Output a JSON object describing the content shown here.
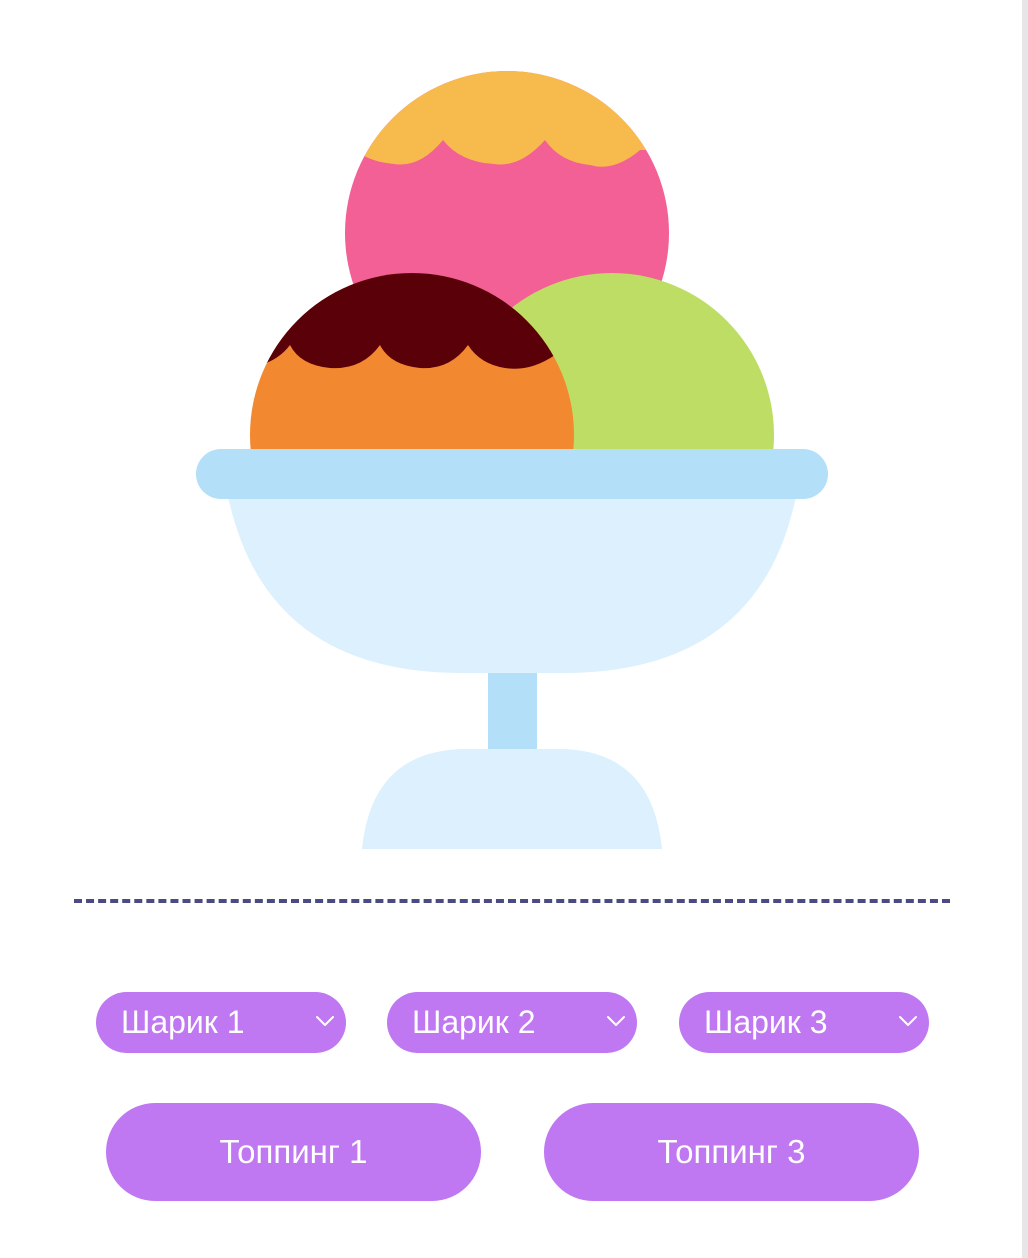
{
  "scoop_selects": [
    {
      "value": "Шарик 1",
      "icon": "chevron-down-icon"
    },
    {
      "value": "Шарик 2",
      "icon": "chevron-down-icon"
    },
    {
      "value": "Шарик 3",
      "icon": "chevron-down-icon"
    }
  ],
  "topping_buttons": [
    {
      "label": "Топпинг 1"
    },
    {
      "label": "Топпинг 3"
    }
  ],
  "colors": {
    "accent": "#bf77f2",
    "divider": "#4b4a82",
    "scoop_top_base": "#f26096",
    "scoop_top_glaze": "#f7bb4d",
    "scoop_left_base": "#f2882f",
    "scoop_left_glaze": "#5a0008",
    "scoop_right": "#bedd65",
    "bowl_rim": "#b3dff8",
    "bowl": "#dcf0fd"
  }
}
